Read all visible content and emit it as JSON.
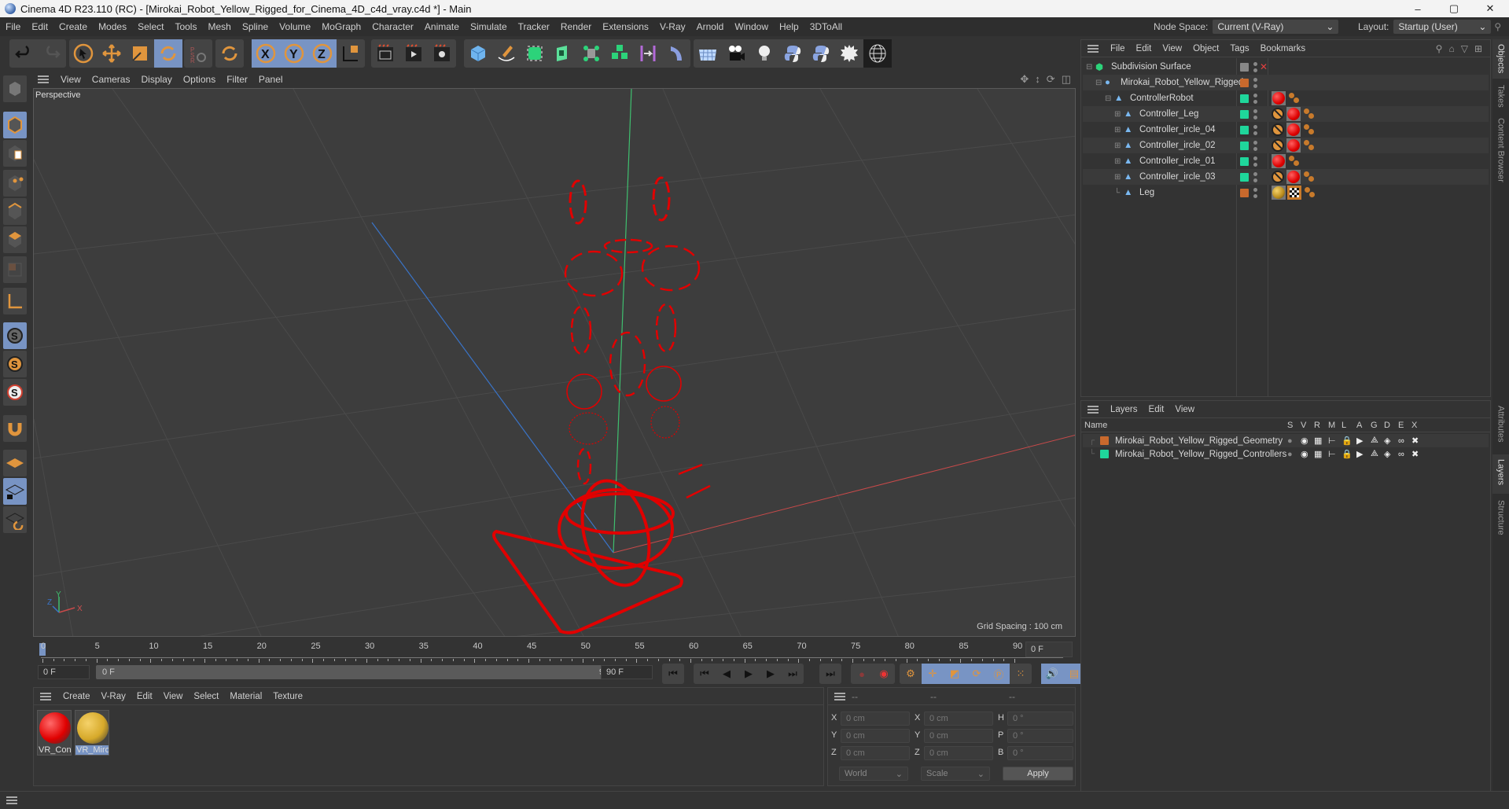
{
  "window": {
    "title": "Cinema 4D R23.110 (RC) - [Mirokai_Robot_Yellow_Rigged_for_Cinema_4D_c4d_vray.c4d *] - Main",
    "controls": {
      "minimize": "–",
      "maximize": "▢",
      "close": "✕"
    }
  },
  "menubar": {
    "items": [
      "File",
      "Edit",
      "Create",
      "Modes",
      "Select",
      "Tools",
      "Mesh",
      "Spline",
      "Volume",
      "MoGraph",
      "Character",
      "Animate",
      "Simulate",
      "Tracker",
      "Render",
      "Extensions",
      "V-Ray",
      "Arnold",
      "Window",
      "Help",
      "3DToAll"
    ],
    "node_space_label": "Node Space:",
    "node_space_value": "Current (V-Ray)",
    "layout_label": "Layout:",
    "layout_value": "Startup (User)"
  },
  "toolbar": {
    "icons": [
      "undo-icon",
      "redo-icon",
      "select-icon",
      "move-icon",
      "scale-icon",
      "rotate-icon",
      "psr-icon",
      "recent-rotate-icon",
      "x-axis-icon",
      "y-axis-icon",
      "z-axis-icon",
      "coordinate-system-icon",
      "render-view-icon",
      "render-picture-viewer-icon",
      "render-settings-icon",
      "cube-icon",
      "pen-icon",
      "subdivision-icon",
      "extrude-icon",
      "array-icon",
      "cloner-icon",
      "symmetry-icon",
      "deformer-icon",
      "floor-icon",
      "camera-icon",
      "light-icon",
      "python-icon",
      "python2-icon",
      "explosion-icon",
      "sky-sphere-icon"
    ]
  },
  "viewport": {
    "menu": [
      "View",
      "Cameras",
      "Display",
      "Options",
      "Filter",
      "Panel"
    ],
    "label": "Perspective",
    "grid_spacing": "Grid Spacing : 100 cm",
    "axis_labels": {
      "x": "X",
      "y": "Y",
      "z": "Z"
    }
  },
  "timeline": {
    "ticks": [
      "0",
      "5",
      "10",
      "15",
      "20",
      "25",
      "30",
      "35",
      "40",
      "45",
      "50",
      "55",
      "60",
      "65",
      "70",
      "75",
      "80",
      "85",
      "90"
    ],
    "current_frame": "0 F",
    "start_field": "0 F",
    "range_start": "0 F",
    "range_end": "90 F",
    "end_field": "90 F"
  },
  "materials": {
    "menu": [
      "Create",
      "V-Ray",
      "Edit",
      "View",
      "Select",
      "Material",
      "Texture"
    ],
    "items": [
      {
        "label": "VR_Cont",
        "color": "#e00000",
        "selected": false
      },
      {
        "label": "VR_Miro",
        "color": "#d6a92a",
        "selected": true
      }
    ]
  },
  "coordinates": {
    "headers": [
      "--",
      "--",
      "--"
    ],
    "rows": [
      {
        "l1": "X",
        "v1": "0 cm",
        "l2": "X",
        "v2": "0 cm",
        "l3": "H",
        "v3": "0 °"
      },
      {
        "l1": "Y",
        "v1": "0 cm",
        "l2": "Y",
        "v2": "0 cm",
        "l3": "P",
        "v3": "0 °"
      },
      {
        "l1": "Z",
        "v1": "0 cm",
        "l2": "Z",
        "v2": "0 cm",
        "l3": "B",
        "v3": "0 °"
      }
    ],
    "space_value": "World",
    "mode_value": "Scale",
    "apply_label": "Apply"
  },
  "objects": {
    "menu": [
      "File",
      "Edit",
      "View",
      "Object",
      "Tags",
      "Bookmarks"
    ],
    "items": [
      {
        "name": "Subdivision Surface",
        "depth": 0,
        "color": "#888888",
        "tags": []
      },
      {
        "name": "Mirokai_Robot_Yellow_Rigged",
        "depth": 1,
        "color": "#c8692d",
        "tags": []
      },
      {
        "name": "ControllerRobot",
        "depth": 2,
        "color": "#1fd69b",
        "tags": [
          "material-red",
          "ik"
        ]
      },
      {
        "name": "Controller_Leg",
        "depth": 3,
        "color": "#1fd69b",
        "tags": [
          "protection",
          "material-red",
          "ik"
        ]
      },
      {
        "name": "Controller_ircle_04",
        "depth": 3,
        "color": "#1fd69b",
        "tags": [
          "protection",
          "material-red",
          "ik"
        ]
      },
      {
        "name": "Controller_ircle_02",
        "depth": 3,
        "color": "#1fd69b",
        "tags": [
          "protection",
          "material-red",
          "ik"
        ]
      },
      {
        "name": "Controller_ircle_01",
        "depth": 3,
        "color": "#1fd69b",
        "tags": [
          "material-red",
          "ik"
        ]
      },
      {
        "name": "Controller_ircle_03",
        "depth": 3,
        "color": "#1fd69b",
        "tags": [
          "protection",
          "material-red",
          "ik"
        ]
      },
      {
        "name": "Leg",
        "depth": 3,
        "color": "#c8692d",
        "tags": [
          "material-yellow",
          "checker",
          "ik"
        ]
      }
    ]
  },
  "layers": {
    "menu": [
      "Layers",
      "Edit",
      "View"
    ],
    "columns": [
      "Name",
      "S",
      "V",
      "R",
      "M",
      "L",
      "A",
      "G",
      "D",
      "E",
      "X"
    ],
    "items": [
      {
        "name": "Mirokai_Robot_Yellow_Rigged_Geometry",
        "color": "#c8692d"
      },
      {
        "name": "Mirokai_Robot_Yellow_Rigged_Controllers",
        "color": "#1fd69b"
      }
    ]
  },
  "side_tabs": {
    "top": [
      "Objects",
      "Takes",
      "Content Browser"
    ],
    "bottom": [
      "Attributes",
      "Layers",
      "Structure"
    ]
  }
}
